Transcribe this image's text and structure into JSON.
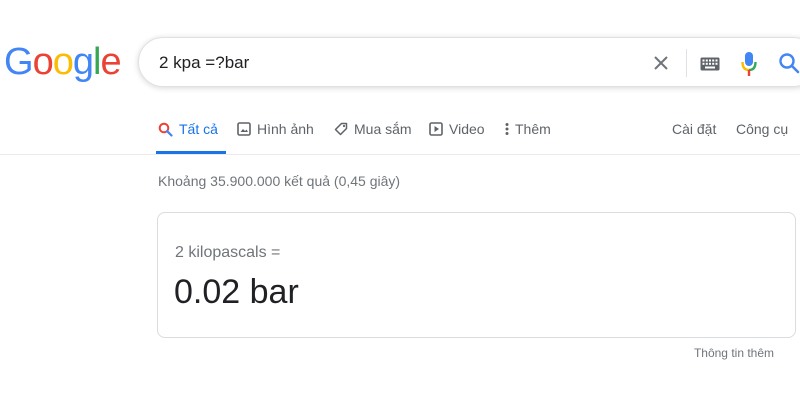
{
  "logo": {
    "letters": [
      "G",
      "o",
      "o",
      "g",
      "l",
      "e"
    ],
    "colors": [
      "#4285F4",
      "#EA4335",
      "#FBBC05",
      "#4285F4",
      "#34A853",
      "#EA4335"
    ]
  },
  "search": {
    "query": "2 kpa =?bar",
    "icons": [
      "close-icon",
      "keyboard-icon",
      "mic-icon",
      "search-icon"
    ]
  },
  "tabs": [
    {
      "label": "Tất cả",
      "icon": "search-icon",
      "active": true
    },
    {
      "label": "Hình ảnh",
      "icon": "image-icon",
      "active": false
    },
    {
      "label": "Mua sắm",
      "icon": "tag-icon",
      "active": false
    },
    {
      "label": "Video",
      "icon": "play-icon",
      "active": false
    },
    {
      "label": "Thêm",
      "icon": "more-vert-icon",
      "active": false
    }
  ],
  "tools": {
    "settings": "Cài đặt",
    "tools": "Công cụ"
  },
  "stats": "Khoảng 35.900.000 kết quả (0,45 giây)",
  "converter": {
    "from": "2 kilopascals =",
    "to": "0.02 bar"
  },
  "more_info": "Thông tin thêm",
  "colors": {
    "accent": "#1a73e8",
    "mic_blue": "#4285F4",
    "mic_red": "#EA4335",
    "mic_yellow": "#FBBC05",
    "mic_green": "#34A853"
  }
}
